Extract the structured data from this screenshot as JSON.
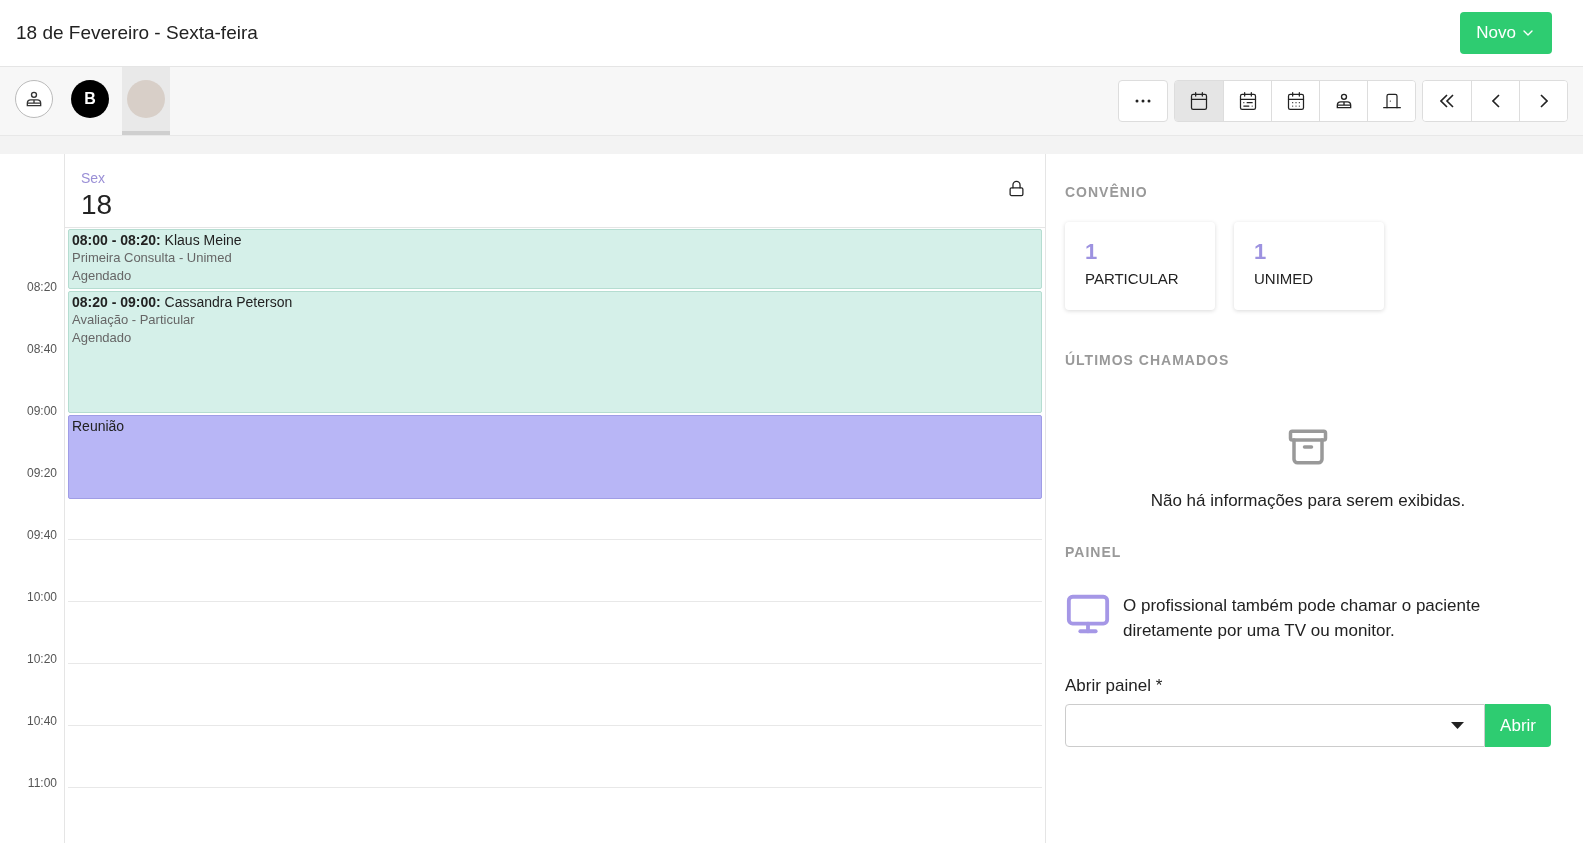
{
  "header": {
    "title": "18 de Fevereiro - Sexta-feira",
    "new_button": "Novo"
  },
  "professionals": [
    {
      "kind": "icon",
      "selected": false
    },
    {
      "kind": "initial",
      "label": "B",
      "selected": false
    },
    {
      "kind": "photo",
      "selected": true
    }
  ],
  "view_buttons": [
    {
      "kind": "more",
      "selected": false
    },
    {
      "kind": "day",
      "selected": true
    },
    {
      "kind": "week",
      "selected": false
    },
    {
      "kind": "month",
      "selected": false
    },
    {
      "kind": "professional",
      "selected": false
    },
    {
      "kind": "door",
      "selected": false
    }
  ],
  "nav_buttons": [
    {
      "kind": "first"
    },
    {
      "kind": "prev"
    },
    {
      "kind": "next"
    }
  ],
  "day": {
    "weekday": "Sex",
    "number": "18"
  },
  "time_labels": [
    "08:20",
    "08:40",
    "09:00",
    "09:20",
    "09:40",
    "10:00",
    "10:20",
    "10:40",
    "11:00"
  ],
  "events": [
    {
      "kind": "appointment",
      "time": "08:00 - 08:20:",
      "name": "Klaus Meine",
      "detail": "Primeira Consulta - Unimed",
      "status": "Agendado"
    },
    {
      "kind": "appointment",
      "time": "08:20 - 09:00:",
      "name": "Cassandra Peterson",
      "detail": "Avaliação - Particular",
      "status": "Agendado"
    },
    {
      "kind": "meeting",
      "name": "Reunião"
    }
  ],
  "convenio": {
    "heading": "CONVÊNIO",
    "cards": [
      {
        "count": "1",
        "label": "PARTICULAR"
      },
      {
        "count": "1",
        "label": "UNIMED"
      }
    ]
  },
  "ultimos_chamados": {
    "heading": "ÚLTIMOS CHAMADOS",
    "empty_text": "Não há informações para serem exibidas."
  },
  "painel": {
    "heading": "PAINEL",
    "text": "O profissional também pode chamar o paciente diretamente por uma TV ou monitor.",
    "field_label": "Abrir painel *",
    "open_button": "Abrir"
  }
}
